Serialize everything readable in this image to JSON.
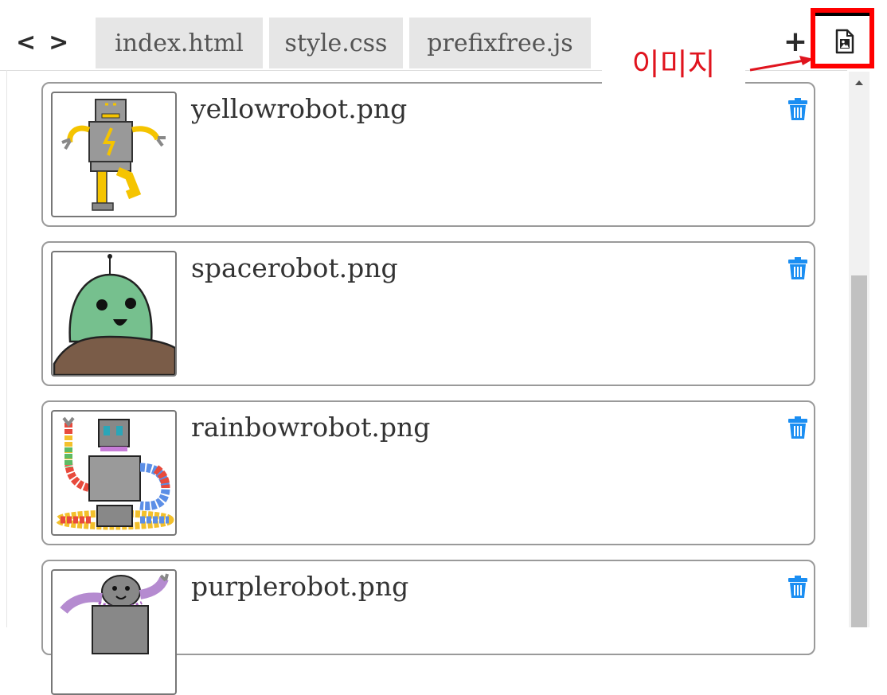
{
  "nav": {
    "back_icon": "chevron-left-icon",
    "forward_icon": "chevron-right-icon",
    "back": "<",
    "forward": ">"
  },
  "tabs": [
    {
      "label": "index.html"
    },
    {
      "label": "style.css"
    },
    {
      "label": "prefixfree.js"
    }
  ],
  "toolbar": {
    "add_label": "+",
    "image_tab_icon": "image-file-icon"
  },
  "annotation": {
    "label": "이미지",
    "color": "#e0141e"
  },
  "files": [
    {
      "name": "yellowrobot.png",
      "thumbnail": "yellow-robot"
    },
    {
      "name": "spacerobot.png",
      "thumbnail": "space-robot"
    },
    {
      "name": "rainbowrobot.png",
      "thumbnail": "rainbow-robot"
    },
    {
      "name": "purplerobot.png",
      "thumbnail": "purple-robot"
    }
  ],
  "colors": {
    "trash": "#1b8ef2",
    "highlight": "#ff0000",
    "tab_bg": "#e6e6e6"
  }
}
